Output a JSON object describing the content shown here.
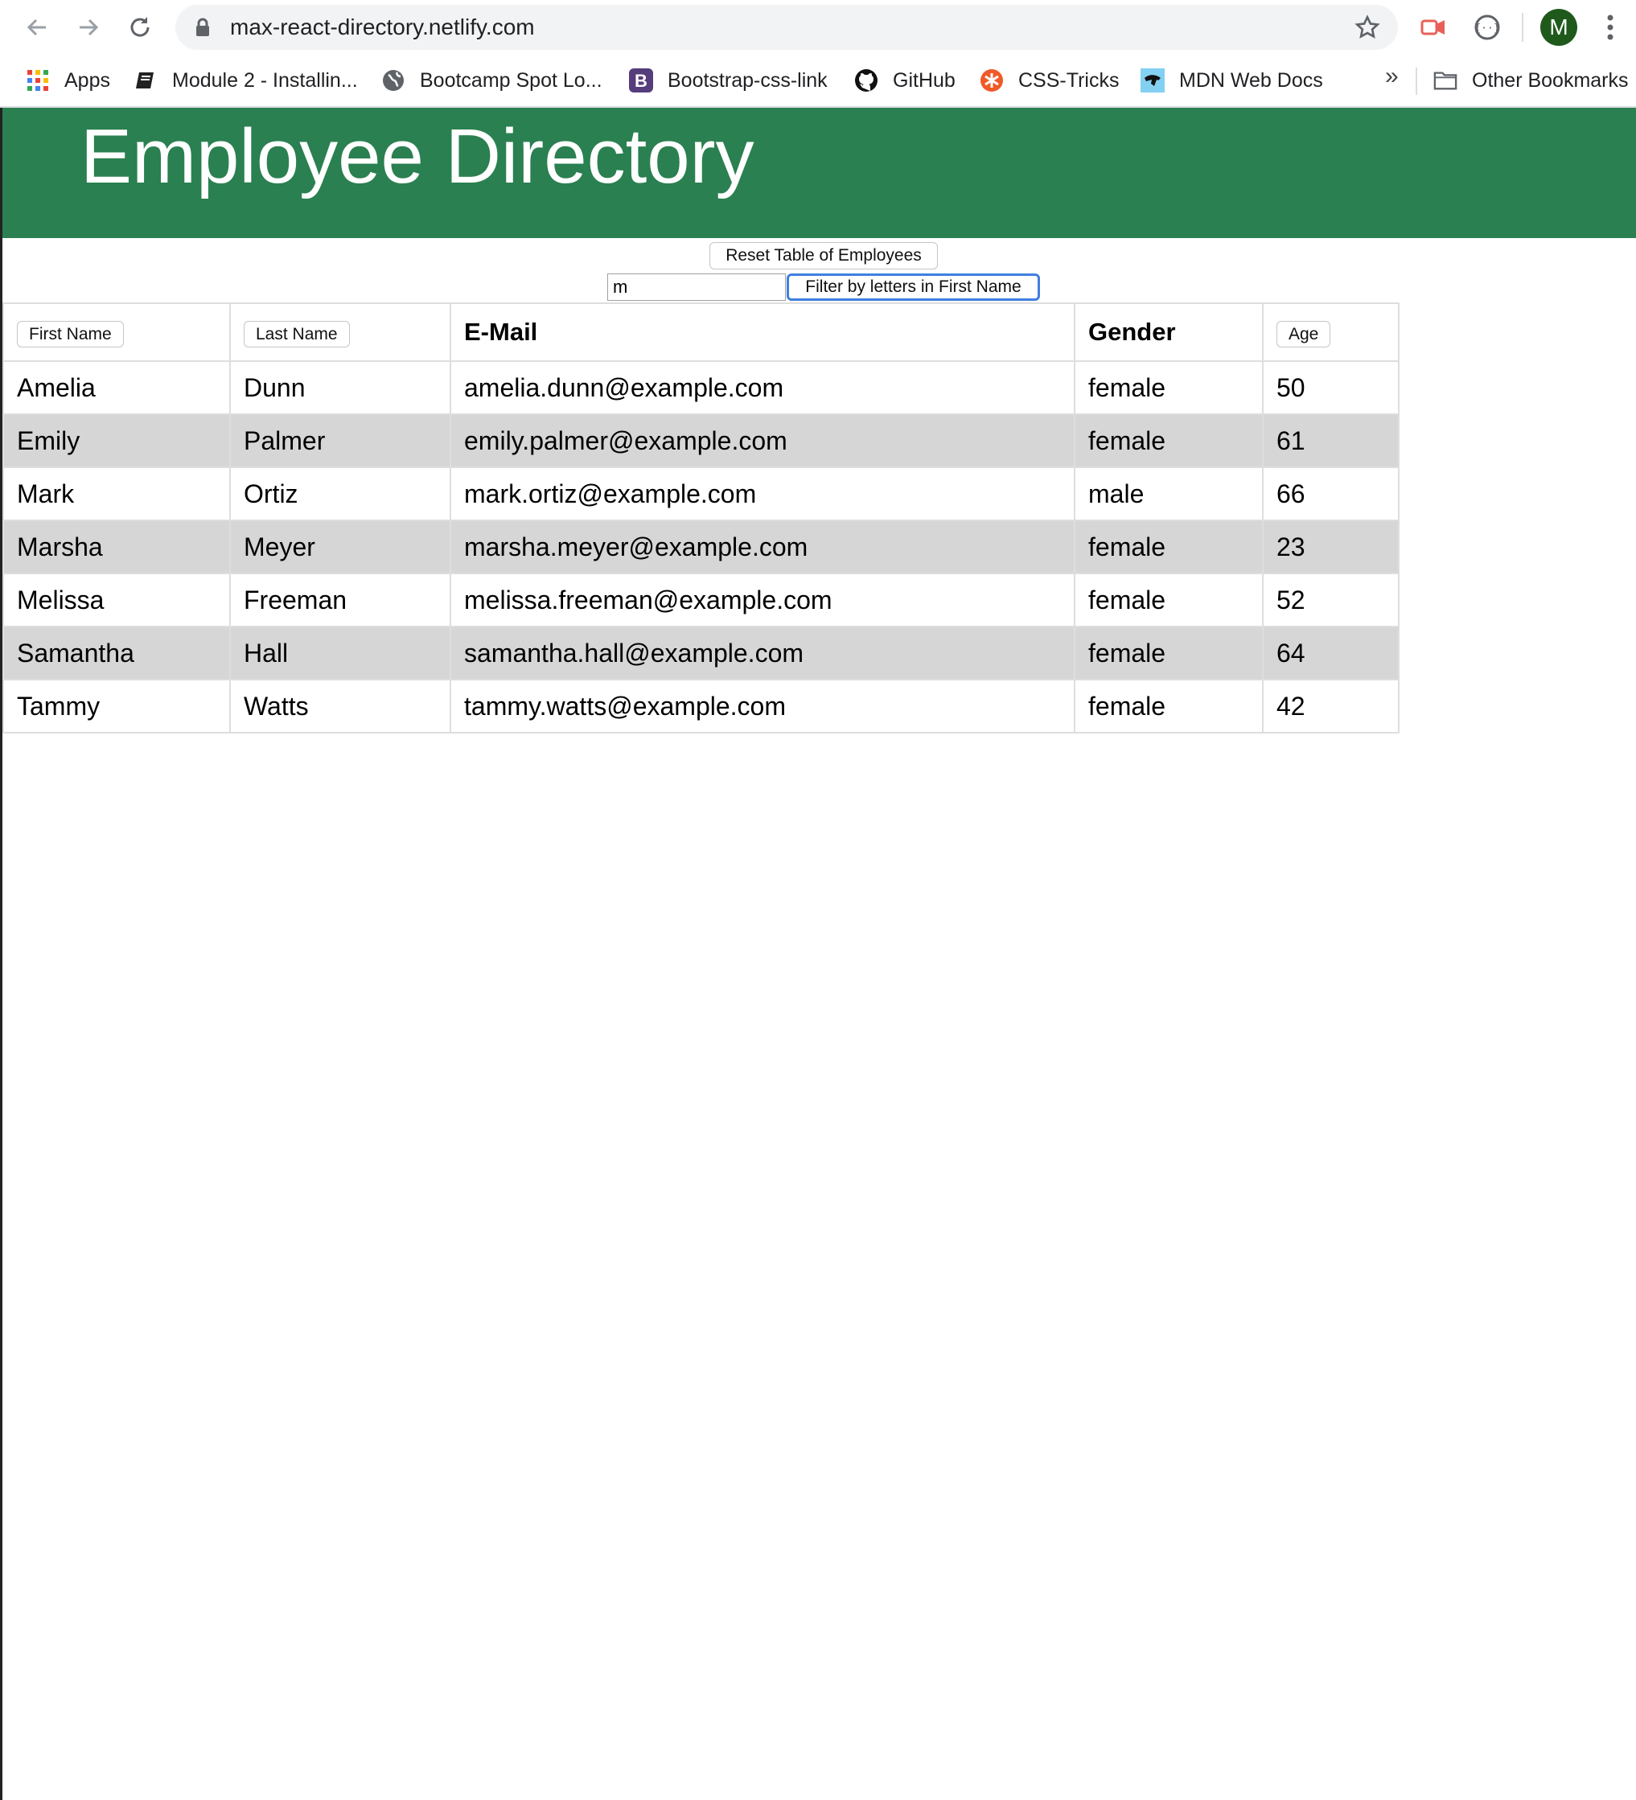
{
  "browser": {
    "url": "max-react-directory.netlify.com",
    "avatar_letter": "M",
    "bookmarks": [
      {
        "label": "Apps",
        "icon": "apps-grid-icon"
      },
      {
        "label": "Module 2 - Installin...",
        "icon": "book-icon"
      },
      {
        "label": "Bootcamp Spot Lo...",
        "icon": "globe-icon"
      },
      {
        "label": "Bootstrap-css-link",
        "icon": "bootstrap-icon"
      },
      {
        "label": "GitHub",
        "icon": "github-icon"
      },
      {
        "label": "CSS-Tricks",
        "icon": "css-tricks-icon"
      },
      {
        "label": "MDN Web Docs",
        "icon": "mdn-icon"
      }
    ],
    "more_bookmarks": "»",
    "other_bookmarks": "Other Bookmarks"
  },
  "page": {
    "title": "Employee Directory",
    "header_color": "#2a8050"
  },
  "controls": {
    "reset_label": "Reset Table of Employees",
    "filter_value": "m",
    "filter_label": "Filter by letters in First Name"
  },
  "table": {
    "columns": [
      "First Name",
      "Last Name",
      "E-Mail",
      "Gender",
      "Age"
    ],
    "rows": [
      [
        "Amelia",
        "Dunn",
        "amelia.dunn@example.com",
        "female",
        "50"
      ],
      [
        "Emily",
        "Palmer",
        "emily.palmer@example.com",
        "female",
        "61"
      ],
      [
        "Mark",
        "Ortiz",
        "mark.ortiz@example.com",
        "male",
        "66"
      ],
      [
        "Marsha",
        "Meyer",
        "marsha.meyer@example.com",
        "female",
        "23"
      ],
      [
        "Melissa",
        "Freeman",
        "melissa.freeman@example.com",
        "female",
        "52"
      ],
      [
        "Samantha",
        "Hall",
        "samantha.hall@example.com",
        "female",
        "64"
      ],
      [
        "Tammy",
        "Watts",
        "tammy.watts@example.com",
        "female",
        "42"
      ]
    ]
  }
}
